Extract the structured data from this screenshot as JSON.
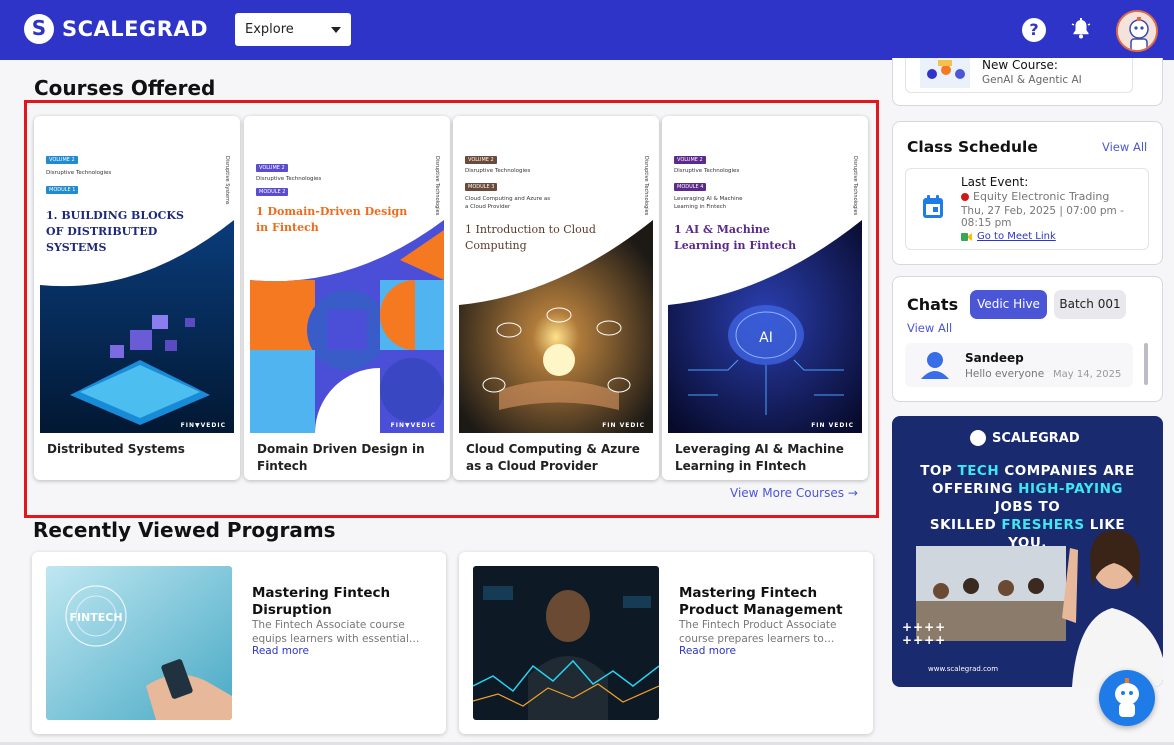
{
  "header": {
    "brand": "SCALEGRAD",
    "explore_label": "Explore",
    "help_glyph": "?",
    "colors": {
      "bar": "#2e34c8",
      "accent": "#4a56d6",
      "highlight_border": "#e2161d"
    }
  },
  "courses": {
    "title": "Courses Offered",
    "view_more": "View More Courses →",
    "items": [
      {
        "name": "Distributed Systems",
        "cover_title": "1. BUILDING BLOCKS OF DISTRIBUTED SYSTEMS",
        "volume": "VOLUME 2",
        "series": "Disruptive Technologies",
        "module": "MODULE 1",
        "module_sub": "",
        "side": "Disruptive Systems",
        "brand": "FIN▼VEDIC",
        "icon": "chip-cubes-art"
      },
      {
        "name": "Domain Driven Design in Fintech",
        "cover_title": "1 Domain-Driven Design in Fintech",
        "volume": "VOLUME 2",
        "series": "Disruptive Technologies",
        "module": "MODULE 2",
        "module_sub": "",
        "side": "Disruptive Technologies",
        "brand": "FIN▼VEDIC",
        "icon": "geometric-shapes-art"
      },
      {
        "name": "Cloud Computing & Azure as a Cloud Provider",
        "cover_title": "1 Introduction to Cloud Computing",
        "volume": "VOLUME 2",
        "series": "Disruptive Technologies",
        "module": "MODULE 3",
        "module_sub": "Cloud Computing and Azure as a Cloud Provider",
        "side": "Disruptive Technologies",
        "brand": "FIN VEDIC",
        "icon": "cloud-hands-art"
      },
      {
        "name": "Leveraging AI & Machine Learning in FIntech",
        "cover_title": "1 AI & Machine Learning in Fintech",
        "volume": "VOLUME 2",
        "series": "Disruptive Technologies",
        "module": "MODULE 4",
        "module_sub": "Leveraging AI & Machine Learning in Fintech",
        "side": "Disruptive Technologies",
        "brand": "FIN VEDIC",
        "ai_label": "AI",
        "icon": "ai-brain-art"
      }
    ]
  },
  "recent": {
    "title": "Recently Viewed Programs",
    "items": [
      {
        "title": "Mastering Fintech Disruption",
        "desc": "The Fintech Associate course equips learners with essential…",
        "read_more": "Read more",
        "image_text": "FINTECH"
      },
      {
        "title": "Mastering Fintech Product Management",
        "desc": "The Fintech Product Associate course prepares learners to…",
        "read_more": "Read more"
      }
    ]
  },
  "sidebar": {
    "new_course": {
      "label": "New Course:",
      "name": "GenAI & Agentic AI"
    },
    "schedule": {
      "title": "Class Schedule",
      "view_all": "View All",
      "last_event_label": "Last Event:",
      "event_name": "Equity Electronic Trading",
      "event_time": "Thu, 27 Feb, 2025 | 07:00 pm - 08:15 pm",
      "meet_link": "Go to Meet Link"
    },
    "chats": {
      "title": "Chats",
      "view_all": "View All",
      "tabs": [
        "Vedic Hive",
        "Batch 001"
      ],
      "active_tab": "Vedic Hive",
      "messages": [
        {
          "name": "Sandeep",
          "text": "Hello everyone",
          "date": "May 14, 2025"
        }
      ]
    },
    "promo": {
      "brand": "SCALEGRAD",
      "line1_a": "TOP ",
      "line1_b": "TECH",
      "line1_c": " COMPANIES ARE",
      "line2_a": "OFFERING ",
      "line2_b": "HIGH-PAYING",
      "line2_c": " JOBS TO",
      "line3_a": "SKILLED ",
      "line3_b": "FRESHERS",
      "line3_c": " LIKE YOU.",
      "plus_grid": "++++ ++++",
      "url": "www.scalegrad.com"
    }
  }
}
